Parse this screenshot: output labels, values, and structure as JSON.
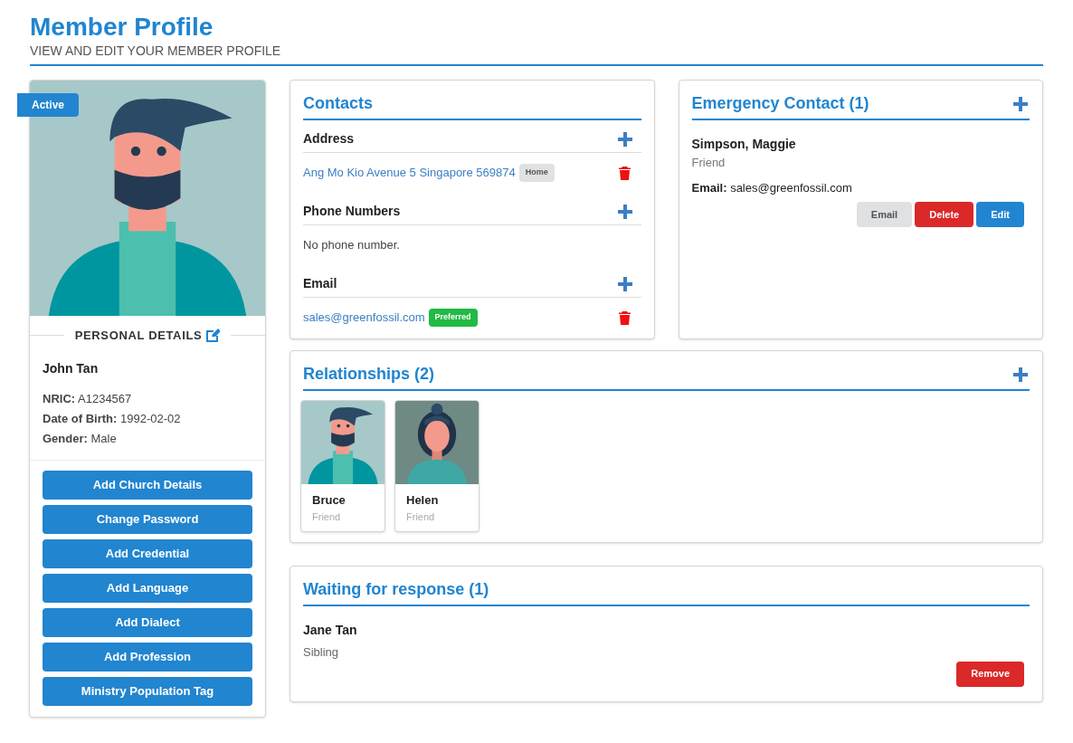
{
  "header": {
    "title": "Member Profile",
    "subtitle": "VIEW AND EDIT YOUR MEMBER PROFILE"
  },
  "profile": {
    "status": "Active",
    "section_title": "PERSONAL DETAILS",
    "name": "John Tan",
    "fields": [
      {
        "label": "NRIC:",
        "value": "A1234567"
      },
      {
        "label": "Date of Birth:",
        "value": "1992-02-02"
      },
      {
        "label": "Gender:",
        "value": "Male"
      }
    ],
    "actions": [
      "Add Church Details",
      "Change Password",
      "Add Credential",
      "Add Language",
      "Add Dialect",
      "Add Profession",
      "Ministry Population Tag"
    ]
  },
  "contacts": {
    "title": "Contacts",
    "sections": [
      {
        "title": "Address",
        "items": [
          {
            "text": "Ang Mo Kio Avenue 5 Singapore 569874",
            "tag": "Home",
            "kind": "neutral"
          }
        ]
      },
      {
        "title": "Phone Numbers",
        "empty": "No phone number."
      },
      {
        "title": "Email",
        "items": [
          {
            "text": "sales@greenfossil.com",
            "tag": "Preferred",
            "kind": "success"
          }
        ]
      }
    ]
  },
  "emergency": {
    "title": "Emergency Contact (1)",
    "name": "Simpson, Maggie",
    "relation": "Friend",
    "email_label": "Email:",
    "email": "sales@greenfossil.com",
    "buttons": [
      {
        "label": "Email",
        "kind": "neutral"
      },
      {
        "label": "Delete",
        "kind": "danger"
      },
      {
        "label": "Edit",
        "kind": "primary"
      }
    ]
  },
  "relationships": {
    "title": "Relationships (2)",
    "people": [
      {
        "name": "Bruce",
        "relation": "Friend",
        "kind": "man"
      },
      {
        "name": "Helen",
        "relation": "Friend",
        "kind": "woman"
      }
    ]
  },
  "waiting": {
    "title": "Waiting for response (1)",
    "name": "Jane Tan",
    "relation": "Sibling",
    "button": "Remove"
  }
}
